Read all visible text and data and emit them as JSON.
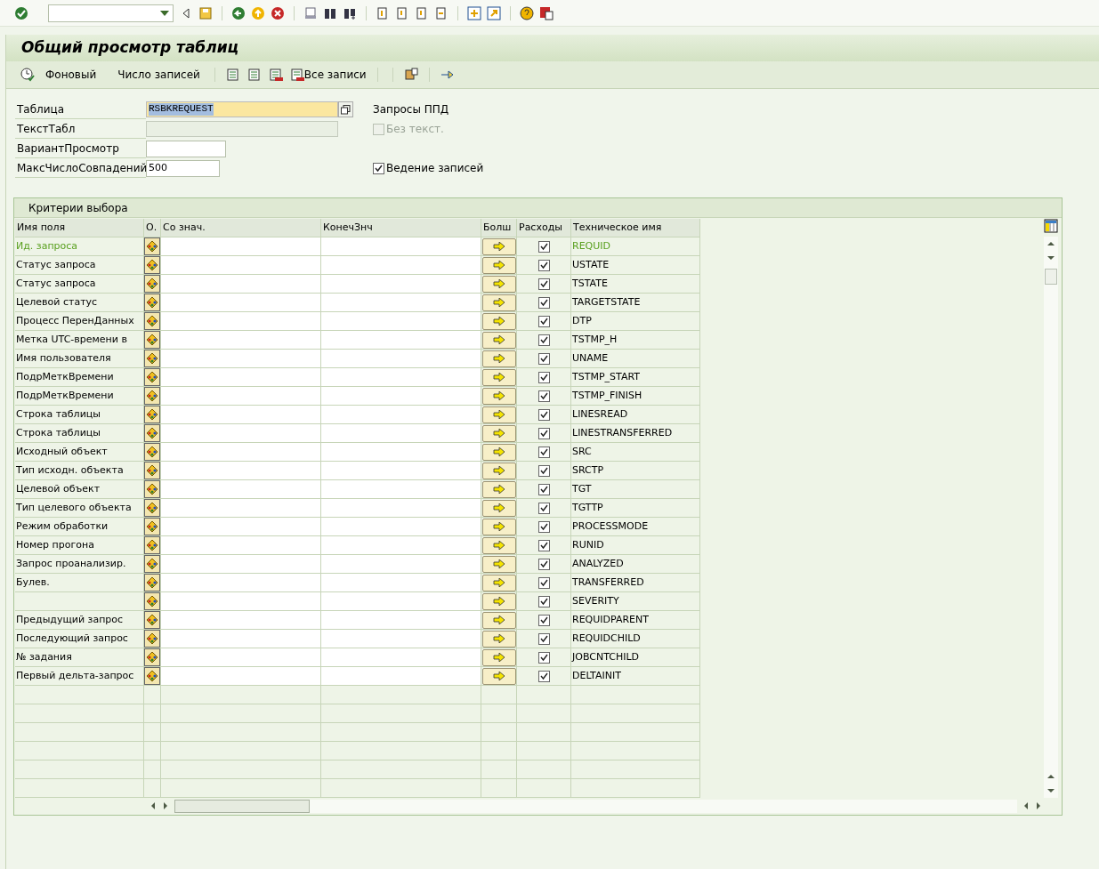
{
  "title": "Общий просмотр таблиц",
  "app_toolbar": [
    {
      "kind": "icon-text",
      "label": "Фоновый"
    },
    {
      "kind": "text",
      "label": "Число записей"
    },
    {
      "kind": "icons-text",
      "label": "Все записи"
    }
  ],
  "fields": [
    {
      "label": "Таблица",
      "value": "RSBKREQUEST",
      "kind": "required"
    },
    {
      "label": "ТекстТабл",
      "kind": "readonly"
    },
    {
      "label": "ВариантПросмотр",
      "kind": "short"
    },
    {
      "label": "МаксЧислоСовпадений",
      "value": "500",
      "kind": "short"
    }
  ],
  "side_label": "Запросы ППД",
  "options": [
    {
      "label": "Без текст.",
      "checked": false,
      "disabled": true
    },
    {
      "label": "Ведение записей",
      "checked": true,
      "disabled": false
    }
  ],
  "group_title": "Критерии выбора",
  "columns": [
    "Имя поля",
    "О.",
    "Со знач.",
    "КонечЗнч",
    "Болш",
    "Расходы",
    "Техническое имя"
  ],
  "rows": [
    {
      "name": "Ид. запроса",
      "key": true,
      "checked": true,
      "tech": "REQUID"
    },
    {
      "name": "Статус запроса",
      "key": false,
      "checked": true,
      "tech": "USTATE"
    },
    {
      "name": "Статус запроса",
      "key": false,
      "checked": true,
      "tech": "TSTATE"
    },
    {
      "name": "Целевой статус",
      "key": false,
      "checked": true,
      "tech": "TARGETSTATE"
    },
    {
      "name": "Процесс ПеренДанных",
      "key": false,
      "checked": true,
      "tech": "DTP"
    },
    {
      "name": "Метка UTC-времени в",
      "key": false,
      "checked": true,
      "tech": "TSTMP_H"
    },
    {
      "name": "Имя пользователя",
      "key": false,
      "checked": true,
      "tech": "UNAME"
    },
    {
      "name": "ПодрМеткВремени",
      "key": false,
      "checked": true,
      "tech": "TSTMP_START"
    },
    {
      "name": "ПодрМеткВремени",
      "key": false,
      "checked": true,
      "tech": "TSTMP_FINISH"
    },
    {
      "name": "Строка таблицы",
      "key": false,
      "checked": true,
      "tech": "LINESREAD"
    },
    {
      "name": "Строка таблицы",
      "key": false,
      "checked": true,
      "tech": "LINESTRANSFERRED"
    },
    {
      "name": "Исходный объект",
      "key": false,
      "checked": true,
      "tech": "SRC"
    },
    {
      "name": "Тип исходн. объекта",
      "key": false,
      "checked": true,
      "tech": "SRCTP"
    },
    {
      "name": "Целевой объект",
      "key": false,
      "checked": true,
      "tech": "TGT"
    },
    {
      "name": "Тип целевого объекта",
      "key": false,
      "checked": true,
      "tech": "TGTTP"
    },
    {
      "name": "Режим обработки",
      "key": false,
      "checked": true,
      "tech": "PROCESSMODE"
    },
    {
      "name": "Номер прогона",
      "key": false,
      "checked": true,
      "tech": "RUNID"
    },
    {
      "name": "Запрос проанализир.",
      "key": false,
      "checked": true,
      "tech": "ANALYZED"
    },
    {
      "name": "Булев.",
      "key": false,
      "checked": true,
      "tech": "TRANSFERRED"
    },
    {
      "key": false,
      "checked": true,
      "tech": "SEVERITY"
    },
    {
      "name": "Предыдущий запрос",
      "key": false,
      "checked": true,
      "tech": "REQUIDPARENT"
    },
    {
      "name": "Последующий запрос",
      "key": false,
      "checked": true,
      "tech": "REQUIDCHILD"
    },
    {
      "name": "№ задания",
      "key": false,
      "checked": true,
      "tech": "JOBCNTCHILD"
    },
    {
      "name": "Первый дельта-запрос",
      "key": false,
      "checked": true,
      "tech": "DELTAINIT"
    }
  ]
}
